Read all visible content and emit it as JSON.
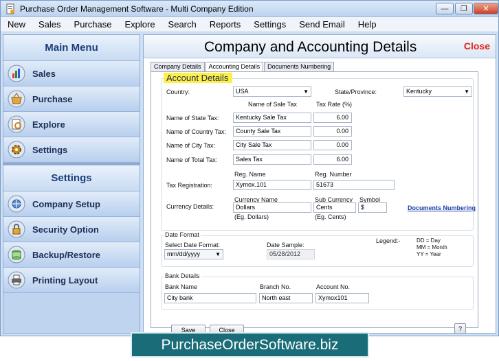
{
  "window": {
    "title": "Purchase Order Management Software - Multi Company Edition",
    "controls": {
      "minimize": "—",
      "maximize": "❐",
      "close": "✕"
    }
  },
  "menubar": [
    "New",
    "Sales",
    "Purchase",
    "Explore",
    "Search",
    "Reports",
    "Settings",
    "Send Email",
    "Help"
  ],
  "sidebar": {
    "main_menu_title": "Main Menu",
    "main_items": [
      {
        "label": "Sales",
        "icon": "sales-chart-icon"
      },
      {
        "label": "Purchase",
        "icon": "purchase-basket-icon"
      },
      {
        "label": "Explore",
        "icon": "explore-icon"
      },
      {
        "label": "Settings",
        "icon": "settings-gear-icon"
      }
    ],
    "settings_title": "Settings",
    "settings_items": [
      {
        "label": "Company Setup",
        "icon": "company-setup-icon"
      },
      {
        "label": "Security Option",
        "icon": "security-lock-icon"
      },
      {
        "label": "Backup/Restore",
        "icon": "backup-icon"
      },
      {
        "label": "Printing Layout",
        "icon": "printer-icon"
      }
    ]
  },
  "content": {
    "title": "Company and Accounting Details",
    "close_label": "Close",
    "tabs": [
      "Company Details",
      "Accounting Details",
      "Documents Numbering"
    ],
    "account_details_heading": "Account Details",
    "country_label": "Country:",
    "country_value": "USA",
    "state_label": "State/Province:",
    "state_value": "Kentucky",
    "col_tax_name": "Name of Sale Tax",
    "col_tax_rate": "Tax Rate (%)",
    "taxes": [
      {
        "label": "Name of State Tax:",
        "name": "Kentucky Sale Tax",
        "rate": "6.00"
      },
      {
        "label": "Name of Country Tax:",
        "name": "County Sale Tax",
        "rate": "0.00"
      },
      {
        "label": "Name of City Tax:",
        "name": "City Sale Tax",
        "rate": "0.00"
      },
      {
        "label": "Name of Total Tax:",
        "name": "Sales Tax",
        "rate": "6.00"
      }
    ],
    "reg_name_header": "Reg. Name",
    "reg_number_header": "Reg. Number",
    "tax_reg_label": "Tax Registration:",
    "reg_name_value": "Xymox.101",
    "reg_number_value": "51673",
    "currency_label": "Currency Details:",
    "currency_name_header": "Currency Name",
    "sub_currency_header": "Sub Currency",
    "symbol_header": "Symbol",
    "currency_name_value": "Dollars",
    "sub_currency_value": "Cents",
    "symbol_value": "$",
    "currency_example": "(Eg. Dollars)",
    "sub_currency_example": "(Eg. Cents)",
    "documents_numbering_link": "Documents Numbering",
    "date_format_title": "Date Format",
    "select_date_label": "Select Date Format:",
    "date_format_value": "mm/dd/yyyy",
    "date_sample_label": "Date Sample:",
    "date_sample_value": "05/28/2012",
    "legend_label": "Legend:-",
    "legend_lines": [
      "DD = Day",
      "MM = Month",
      "YY = Year"
    ],
    "bank_details_title": "Bank Details",
    "bank_name_header": "Bank Name",
    "branch_no_header": "Branch No.",
    "account_no_header": "Account No.",
    "bank_name_value": "City bank",
    "branch_no_value": "North east",
    "account_no_value": "Xymox101",
    "save_button": "Save",
    "close_button": "Close",
    "help_button": "?"
  },
  "banner": "PurchaseOrderSoftware.biz",
  "colors": {
    "accent_close": "#e0221a",
    "sidebar_bg": "#bfd5ef",
    "banner_bg": "#1a6d78",
    "heading_highlight": "#ffee44"
  }
}
